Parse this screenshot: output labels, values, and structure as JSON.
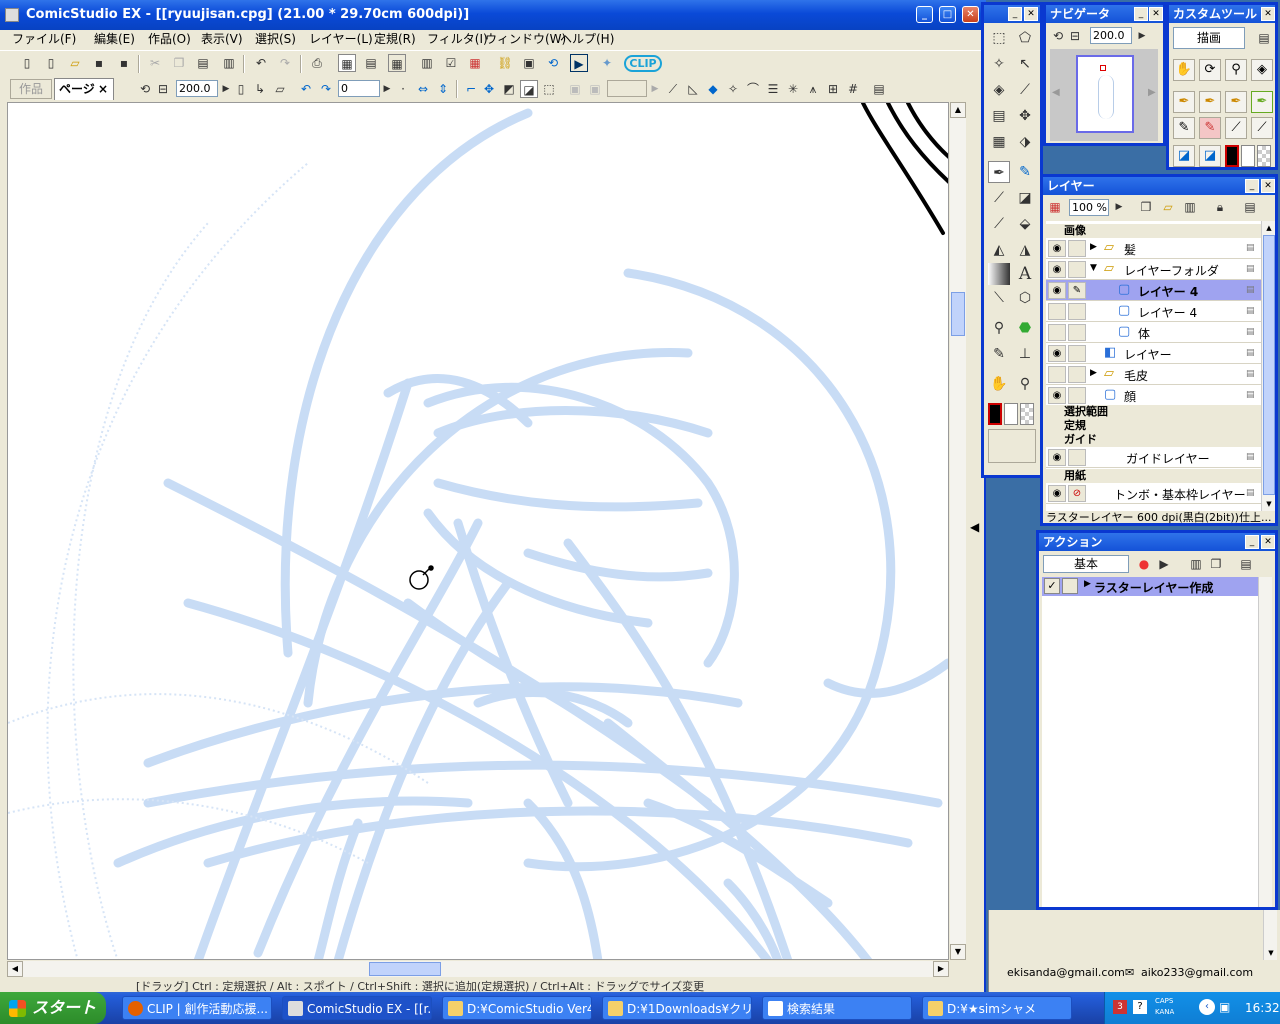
{
  "app": {
    "title": "ComicStudio EX - [[ryuujisan.cpg] (21.00 * 29.70cm 600dpi)]"
  },
  "menu": [
    "ファイル(F)",
    "編集(E)",
    "作品(O)",
    "表示(V)",
    "選択(S)",
    "レイヤー(L)",
    "定規(R)",
    "フィルタ(I)",
    "ウィンドウ(W)",
    "ヘルプ(H)"
  ],
  "tabs": {
    "work": "作品",
    "page": "ページ",
    "close": "×"
  },
  "toolbar": {
    "zoom": "200.0",
    "rotation": "0",
    "clip": "CLIP"
  },
  "status_text": "[ドラッグ] Ctrl : 定規選択 / Alt : スポイト / Ctrl+Shift : 選択に追加(定規選択) / Ctrl+Alt : ドラッグでサイズ変更",
  "navigator": {
    "title": "ナビゲータ",
    "zoom": "200.0"
  },
  "custom_tools": {
    "title": "カスタムツール",
    "set": "描画"
  },
  "layers": {
    "title": "レイヤー",
    "opacity": "100 %",
    "root": "画像",
    "rows": [
      {
        "name": "髪",
        "kind": "folder",
        "indent": 1,
        "eye": true,
        "selected": false
      },
      {
        "name": "レイヤーフォルダ",
        "kind": "folder-open",
        "indent": 1,
        "eye": true,
        "selected": false
      },
      {
        "name": "レイヤー 4",
        "kind": "raster",
        "indent": 2,
        "eye": true,
        "selected": true
      },
      {
        "name": "レイヤー 4",
        "kind": "raster",
        "indent": 2,
        "eye": false,
        "selected": false
      },
      {
        "name": "体",
        "kind": "raster",
        "indent": 2,
        "eye": false,
        "selected": false
      },
      {
        "name": "レイヤー",
        "kind": "vector",
        "indent": 1,
        "eye": true,
        "selected": false
      },
      {
        "name": "毛皮",
        "kind": "folder",
        "indent": 1,
        "eye": false,
        "selected": false
      },
      {
        "name": "顔",
        "kind": "raster",
        "indent": 1,
        "eye": true,
        "selected": false
      }
    ],
    "groups": {
      "selection": "選択範囲",
      "ruler": "定規",
      "guide": "ガイド",
      "guide_layer": "ガイドレイヤー",
      "paper": "用紙",
      "paper_layer": "トンボ・基本枠レイヤー"
    },
    "info": "ラスターレイヤー 600 dpi(黒白(2bit))仕上..."
  },
  "actions": {
    "title": "アクション",
    "set": "基本",
    "item": "ラスターレイヤー作成"
  },
  "emails": [
    "ekisanda@gmail.com",
    "aiko233@gmail.com"
  ],
  "taskbar": {
    "start": "スタート",
    "items": [
      "CLIP | 創作活動応援...",
      "ComicStudio EX - [[r...",
      "D:¥ComicStudio Ver4...",
      "D:¥1Downloads¥クリッ...",
      "検索結果",
      "D:¥★simシャメ"
    ],
    "caps": "CAPS",
    "kana": "KANA",
    "time": "16:32"
  },
  "colors": {
    "xp_blue": "#0a4ad8",
    "sketch": "#c8dcf5",
    "selected_layer": "#9fa3f0"
  }
}
